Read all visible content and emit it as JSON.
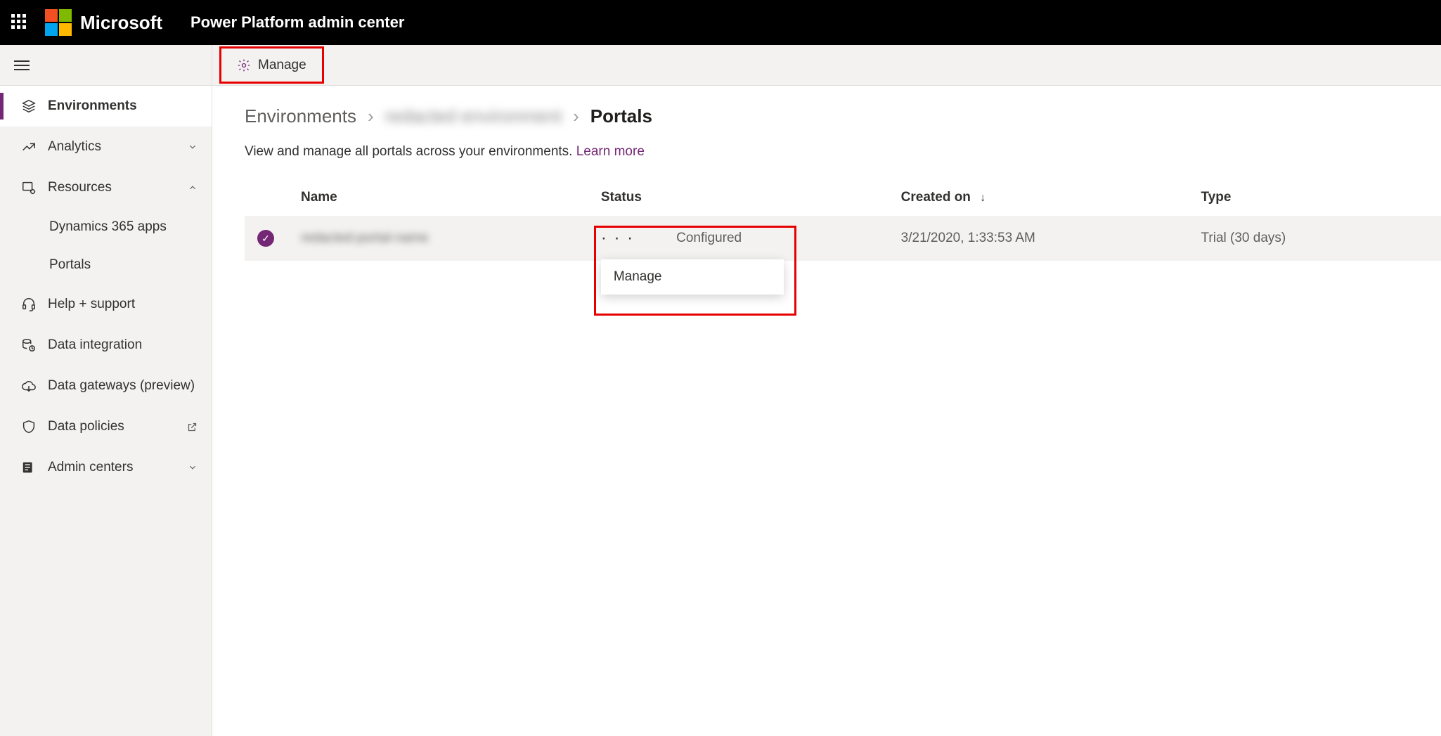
{
  "header": {
    "brand": "Microsoft",
    "app_title": "Power Platform admin center"
  },
  "sidebar": {
    "items": [
      {
        "label": "Environments"
      },
      {
        "label": "Analytics"
      },
      {
        "label": "Resources"
      },
      {
        "label": "Help + support"
      },
      {
        "label": "Data integration"
      },
      {
        "label": "Data gateways (preview)"
      },
      {
        "label": "Data policies"
      },
      {
        "label": "Admin centers"
      }
    ],
    "resources_children": [
      {
        "label": "Dynamics 365 apps"
      },
      {
        "label": "Portals"
      }
    ]
  },
  "command_bar": {
    "manage_label": "Manage"
  },
  "breadcrumb": {
    "root": "Environments",
    "mid_redacted": "redacted environment",
    "current": "Portals"
  },
  "page": {
    "subtext": "View and manage all portals across your environments.",
    "learn_more": "Learn more"
  },
  "table": {
    "columns": {
      "name": "Name",
      "status": "Status",
      "created_on": "Created on",
      "type": "Type"
    },
    "rows": [
      {
        "name_redacted": "redacted-portal-name",
        "status": "Configured",
        "created_on": "3/21/2020, 1:33:53 AM",
        "type": "Trial (30 days)"
      }
    ]
  },
  "context_menu": {
    "manage": "Manage"
  }
}
